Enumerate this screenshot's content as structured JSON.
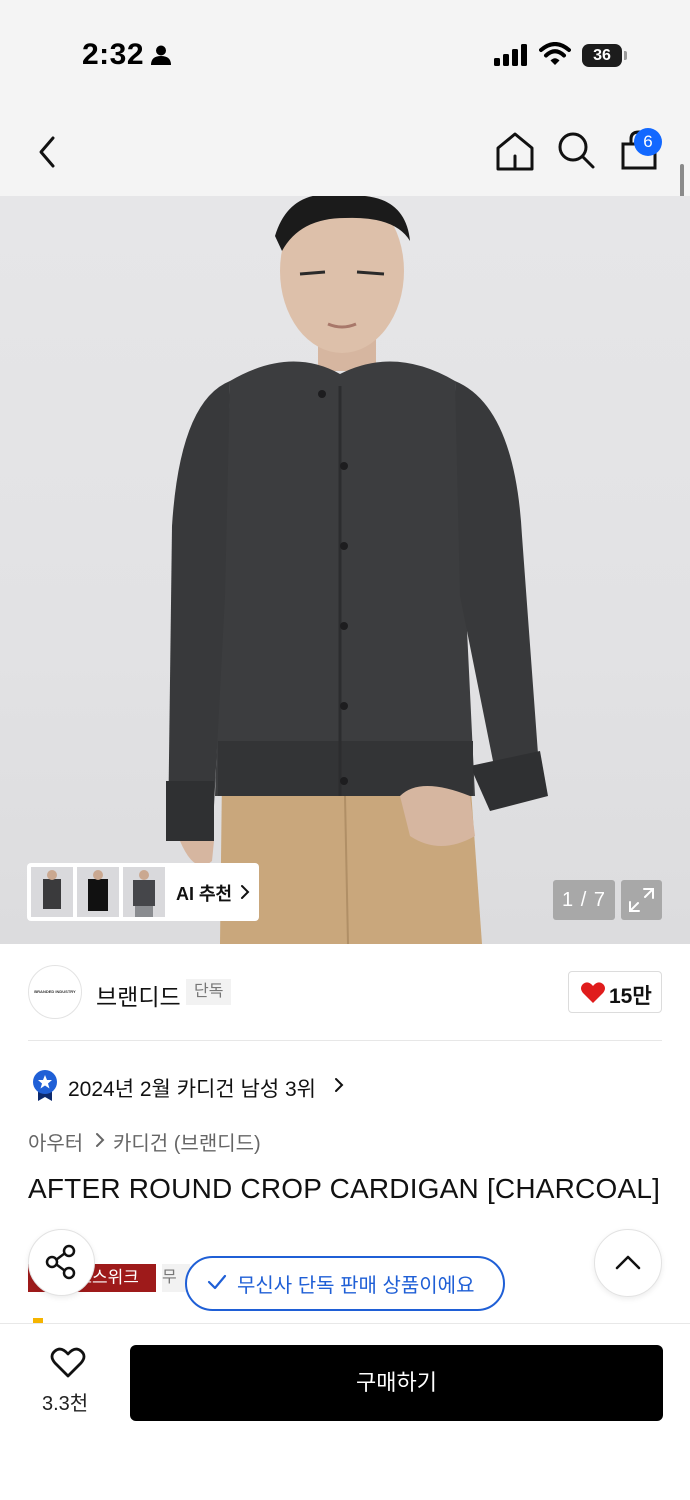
{
  "status_bar": {
    "time": "2:32",
    "battery": "36"
  },
  "header": {
    "cart_count": "6"
  },
  "gallery": {
    "ai_label": "AI 추천",
    "page_counter": "1 / 7"
  },
  "brand": {
    "logo_text": "BRANDED INDUSTRY",
    "name": "브랜디드",
    "exclusive_tag": "단독",
    "likes": "15만"
  },
  "ranking": {
    "text": "2024년 2월 카디건 남성 3위"
  },
  "product": {
    "category_top": "아우터",
    "category_sub": "카디건 (브랜디드)",
    "title": "AFTER ROUND CROP CARDIGAN [CHARCOAL]",
    "tag_event": "브랜드스위크",
    "tag_extra": "무"
  },
  "toast": {
    "text": "무신사 단독 판매 상품이에요"
  },
  "bottom_bar": {
    "wish_count": "3.3천",
    "buy_label": "구매하기"
  },
  "colors": {
    "accent_blue": "#1f5fd6",
    "badge_blue": "#1268ff",
    "like_red": "#e01c1c",
    "tag_red": "#9e1a1a",
    "buy_black": "#000000"
  }
}
